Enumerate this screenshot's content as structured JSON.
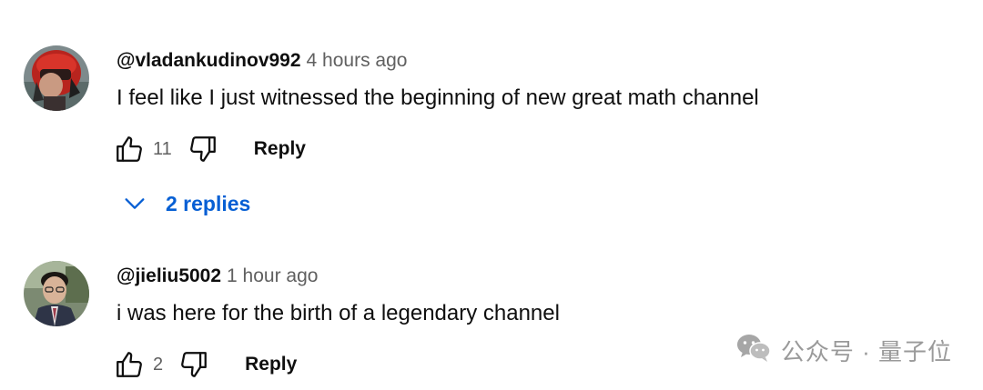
{
  "comments": [
    {
      "author": "@vladankudinov992",
      "time": "4 hours ago",
      "text": "I feel like I just witnessed the beginning of new great math channel",
      "likes": "11",
      "reply_label": "Reply",
      "replies_label": "2 replies"
    },
    {
      "author": "@jieliu5002",
      "time": "1 hour ago",
      "text": "i was here for the birth of a legendary channel",
      "likes": "2",
      "reply_label": "Reply"
    }
  ],
  "watermark": {
    "text": "公众号 · 量子位"
  },
  "icons": {
    "like": "thumb-up-icon",
    "dislike": "thumb-down-icon",
    "expand": "chevron-down-icon",
    "watermark": "wechat-logo-icon"
  },
  "colors": {
    "link_blue": "#065fd4",
    "meta_gray": "#606060",
    "text": "#0f0f0f"
  }
}
